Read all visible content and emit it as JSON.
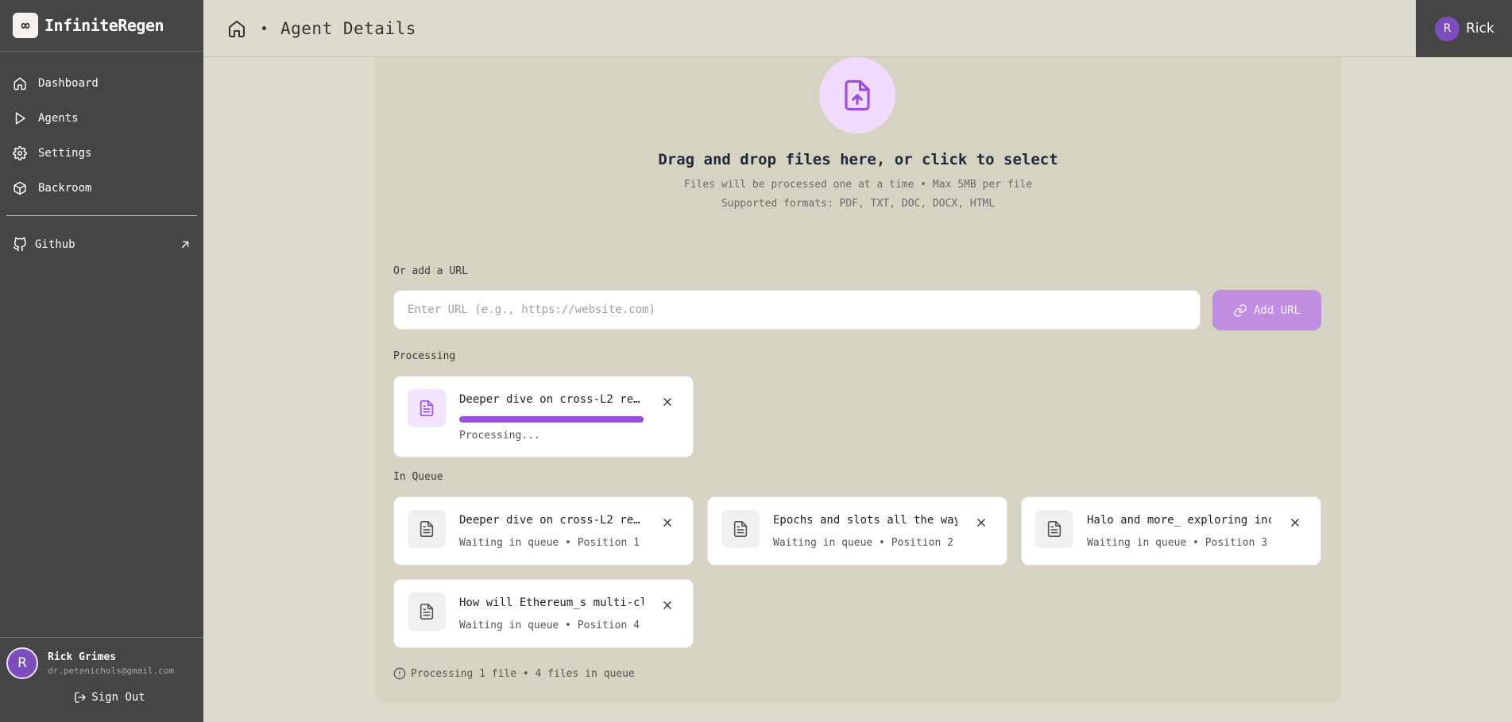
{
  "app": {
    "name": "InfiniteRegen",
    "logo_glyph": "∞"
  },
  "sidebar": {
    "items": [
      {
        "label": "Dashboard",
        "icon": "home-icon"
      },
      {
        "label": "Agents",
        "icon": "play-icon"
      },
      {
        "label": "Settings",
        "icon": "gear-icon"
      },
      {
        "label": "Backroom",
        "icon": "cube-icon"
      }
    ],
    "github": {
      "label": "Github",
      "icon": "github-icon"
    }
  },
  "user": {
    "initial": "R",
    "name": "Rick Grimes",
    "email": "dr.petenichols@gmail.com",
    "short_name": "Rick",
    "sign_out": "Sign Out"
  },
  "header": {
    "title": "Agent Details"
  },
  "upload": {
    "title": "Drag and drop files here, or click to select",
    "line1": "Files will be processed one at a time • Max 5MB per file",
    "line2": "Supported formats: PDF, TXT, DOC, DOCX, HTML"
  },
  "url_section": {
    "label": "Or add a URL",
    "placeholder": "Enter URL (e.g., https://website.com)",
    "value": "",
    "button_label": "Add URL"
  },
  "processing": {
    "label": "Processing",
    "file": {
      "name": "Deeper dive on cross-L2 re…",
      "status": "Processing...",
      "progress": 1.0
    }
  },
  "queue": {
    "label": "In Queue",
    "items": [
      {
        "name": "Deeper dive on cross-L2 re…",
        "status": "Waiting in queue • Position 1"
      },
      {
        "name": "Epochs and slots all the way…",
        "status": "Waiting in queue • Position 2"
      },
      {
        "name": "Halo and more_ exploring inc…",
        "status": "Waiting in queue • Position 3"
      },
      {
        "name": "How will Ethereum_s multi-cli…",
        "status": "Waiting in queue • Position 4"
      }
    ]
  },
  "footer": {
    "note": "Processing 1 file • 4 files in queue"
  },
  "colors": {
    "accent": "#9b4ddd",
    "sidebar": "#454545",
    "background": "#dddbcb",
    "card": "#d6d3c3"
  }
}
